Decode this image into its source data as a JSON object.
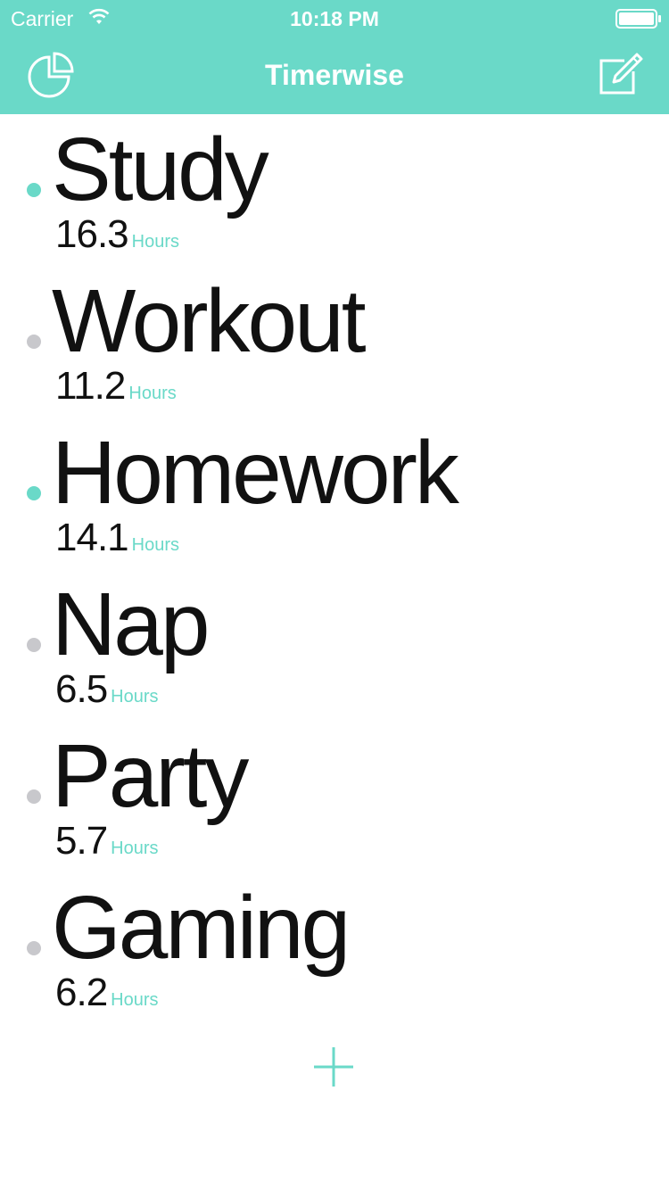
{
  "status_bar": {
    "carrier": "Carrier",
    "time": "10:18 PM"
  },
  "nav": {
    "title": "Timerwise",
    "left_icon": "pie-chart-icon",
    "right_icon": "compose-icon"
  },
  "colors": {
    "accent": "#6ad9c8",
    "inactive_dot": "#c8c8cc",
    "text": "#111111"
  },
  "activities": [
    {
      "name": "Study",
      "hours": "16.3",
      "unit": "Hours",
      "active": true
    },
    {
      "name": "Workout",
      "hours": "11.2",
      "unit": "Hours",
      "active": false
    },
    {
      "name": "Homework",
      "hours": "14.1",
      "unit": "Hours",
      "active": true
    },
    {
      "name": "Nap",
      "hours": "6.5",
      "unit": "Hours",
      "active": false
    },
    {
      "name": "Party",
      "hours": "5.7",
      "unit": "Hours",
      "active": false
    },
    {
      "name": "Gaming",
      "hours": "6.2",
      "unit": "Hours",
      "active": false
    }
  ],
  "add_icon": "plus-icon"
}
